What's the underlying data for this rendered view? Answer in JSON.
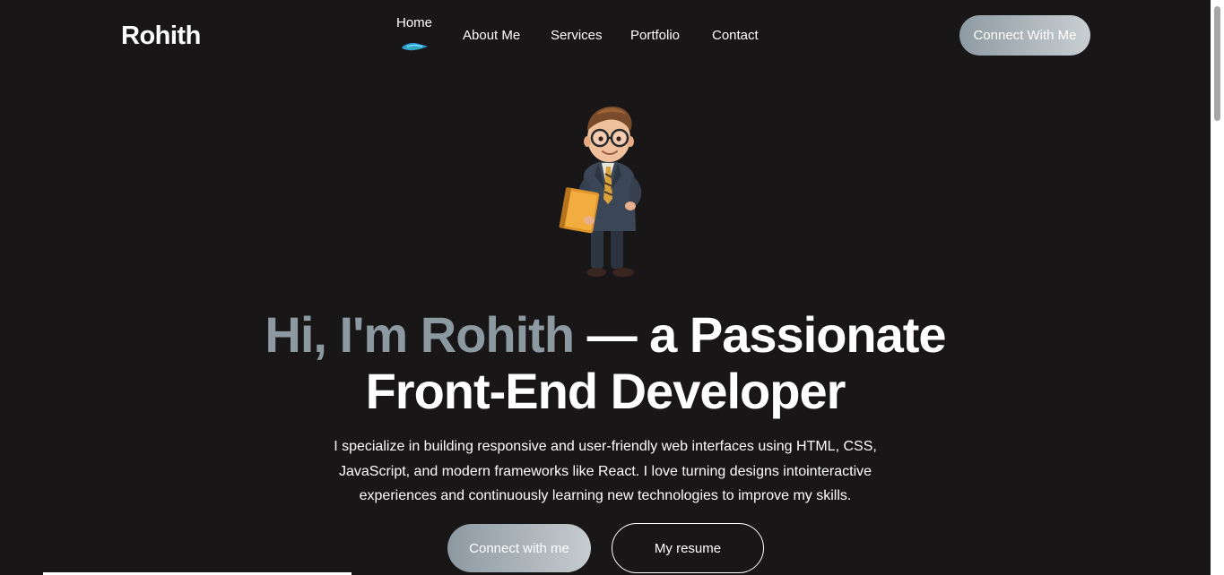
{
  "header": {
    "logo": "Rohith",
    "nav": {
      "home": "Home",
      "about": "About Me",
      "services": "Services",
      "portfolio": "Portfolio",
      "contact": "Contact"
    },
    "cta": "Connect With Me"
  },
  "hero": {
    "avatar_icon": "cartoon-developer-avatar",
    "headline_grey": "Hi, I'm Rohith",
    "headline_white": " — a Passionate",
    "headline_line2": "Front-End Developer",
    "intro_line1": "I specialize in building responsive and user-friendly web interfaces using HTML, CSS,",
    "intro_line2": "JavaScript, and modern frameworks like React. I love turning designs intointeractive",
    "intro_line3": "experiences and continuously learning new technologies to improve my skills.",
    "primary_button": "Connect with me",
    "secondary_button": "My resume"
  },
  "colors": {
    "background": "#181616",
    "accent_grey": "#8c99a1"
  }
}
